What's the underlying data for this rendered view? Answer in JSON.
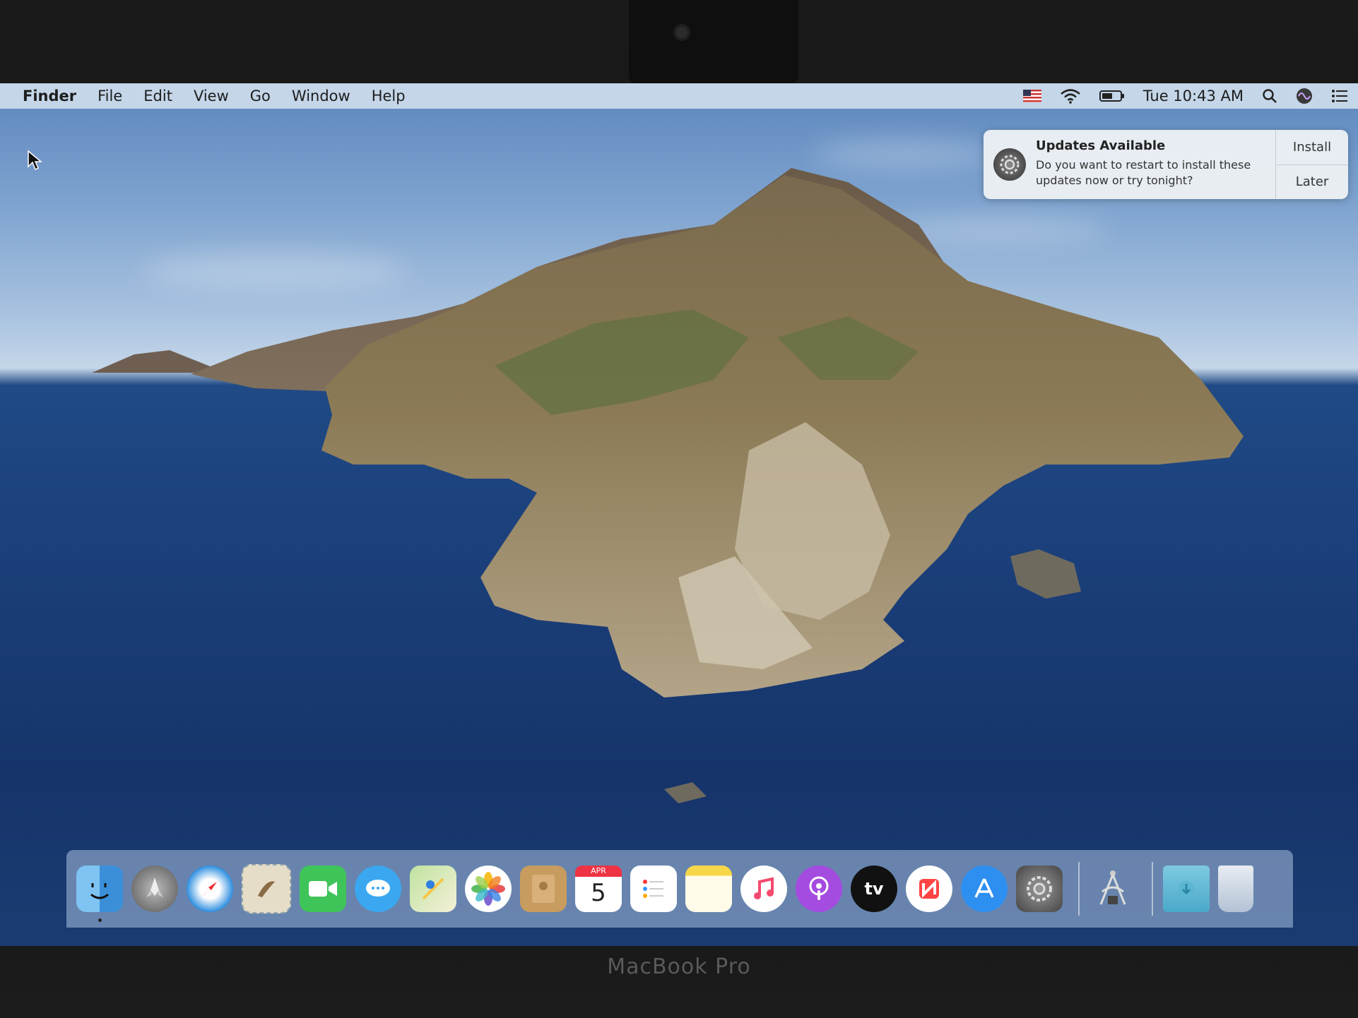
{
  "device": {
    "brand": "MacBook Pro"
  },
  "menubar": {
    "app_name": "Finder",
    "menus": [
      "File",
      "Edit",
      "View",
      "Go",
      "Window",
      "Help"
    ],
    "clock": "Tue 10:43 AM"
  },
  "notification": {
    "title": "Updates Available",
    "message": "Do you want to restart to install these updates now or try tonight?",
    "install_label": "Install",
    "later_label": "Later",
    "icon": "system-preferences-gear-icon"
  },
  "dock": {
    "apps": [
      {
        "name": "Finder",
        "icon": "finder-icon",
        "running": true
      },
      {
        "name": "Launchpad",
        "icon": "launchpad-icon"
      },
      {
        "name": "Safari",
        "icon": "safari-icon"
      },
      {
        "name": "Mail",
        "icon": "mail-icon"
      },
      {
        "name": "FaceTime",
        "icon": "facetime-icon"
      },
      {
        "name": "Messages",
        "icon": "messages-icon"
      },
      {
        "name": "Maps",
        "icon": "maps-icon"
      },
      {
        "name": "Photos",
        "icon": "photos-icon"
      },
      {
        "name": "Contacts",
        "icon": "contacts-icon"
      },
      {
        "name": "Calendar",
        "icon": "calendar-icon",
        "month": "APR",
        "day": "5"
      },
      {
        "name": "Reminders",
        "icon": "reminders-icon"
      },
      {
        "name": "Notes",
        "icon": "notes-icon"
      },
      {
        "name": "Music",
        "icon": "music-icon"
      },
      {
        "name": "Podcasts",
        "icon": "podcasts-icon"
      },
      {
        "name": "TV",
        "icon": "tv-icon",
        "label": "tv"
      },
      {
        "name": "News",
        "icon": "news-icon"
      },
      {
        "name": "App Store",
        "icon": "app-store-icon"
      },
      {
        "name": "System Preferences",
        "icon": "system-preferences-icon"
      },
      {
        "name": "Xcode Instruments",
        "icon": "instruments-icon"
      },
      {
        "name": "Downloads",
        "icon": "downloads-folder-icon"
      },
      {
        "name": "Trash",
        "icon": "trash-icon"
      }
    ]
  },
  "colors": {
    "menubar": "#cddcec",
    "sea": "#1b3f7a",
    "sky": "#a9c3e0",
    "notification": "#ecf0f4"
  }
}
